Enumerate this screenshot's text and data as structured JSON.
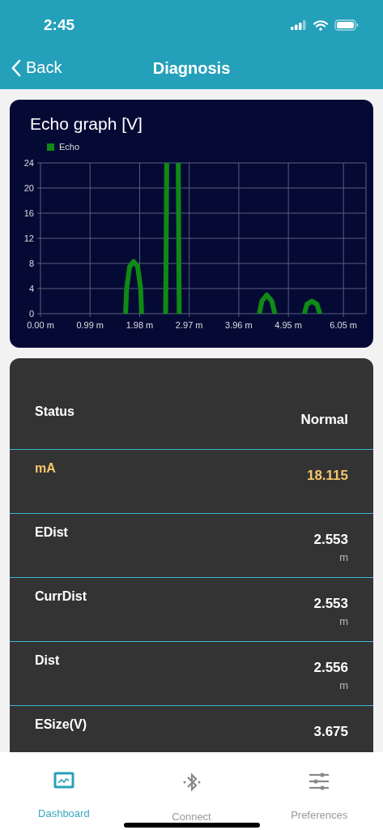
{
  "status_bar": {
    "time": "2:45"
  },
  "nav": {
    "back": "Back",
    "title": "Diagnosis"
  },
  "echo_chart": {
    "chart_data": {
      "type": "line",
      "title": "Echo graph [V]",
      "grid": true,
      "x": [
        1.7,
        1.72,
        1.78,
        1.86,
        1.94,
        2.0,
        2.02,
        2.26,
        2.5,
        2.52,
        2.64,
        2.75,
        2.77,
        3.56,
        4.37,
        4.42,
        4.52,
        4.62,
        4.68,
        4.98,
        5.27,
        5.32,
        5.42,
        5.52,
        5.58
      ],
      "series": [
        {
          "name": "Echo",
          "color": "#0f8a14",
          "values": [
            0,
            4,
            7.5,
            8.3,
            7.5,
            4,
            0,
            null,
            0,
            24,
            null,
            24,
            0,
            null,
            0,
            2,
            3,
            2,
            0,
            null,
            0,
            1.5,
            2,
            1.5,
            0
          ]
        }
      ],
      "xlim": [
        0,
        6.5
      ],
      "ylim": [
        0,
        24
      ],
      "xticks": [
        {
          "value": 0,
          "label": "0.00 m"
        },
        {
          "value": 0.99,
          "label": "0.99 m"
        },
        {
          "value": 1.98,
          "label": "1.98 m"
        },
        {
          "value": 2.97,
          "label": "2.97 m"
        },
        {
          "value": 3.96,
          "label": "3.96 m"
        },
        {
          "value": 4.95,
          "label": "4.95 m"
        },
        {
          "value": 6.05,
          "label": "6.05 m"
        }
      ],
      "yticks": [
        0,
        4,
        8,
        12,
        16,
        20,
        24
      ]
    }
  },
  "readings": [
    {
      "label": "Status",
      "value": "Normal",
      "highlighted": false
    },
    {
      "label": "mA",
      "value": "18.115",
      "highlighted": true
    },
    {
      "label": "EDist",
      "value": "2.553",
      "unit": "m",
      "highlighted": false
    },
    {
      "label": "CurrDist",
      "value": "2.553",
      "unit": "m",
      "highlighted": false
    },
    {
      "label": "Dist",
      "value": "2.556",
      "unit": "m",
      "highlighted": false
    },
    {
      "label": "ESize(V)",
      "value": "3.675",
      "highlighted": false
    }
  ],
  "tab_bar": [
    {
      "label": "Dashboard",
      "selected": true
    },
    {
      "label": "Connect",
      "selected": false
    },
    {
      "label": "Preferences",
      "selected": false
    }
  ]
}
